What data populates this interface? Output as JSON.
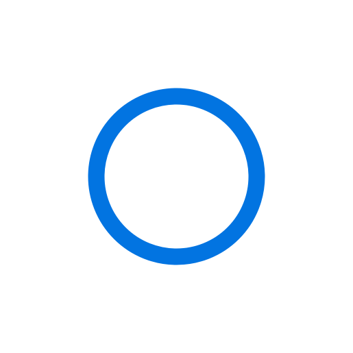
{
  "icon": {
    "name": "circle-outline-icon",
    "stroke_color": "#0274E1",
    "background_color": "#FFFFFF"
  }
}
